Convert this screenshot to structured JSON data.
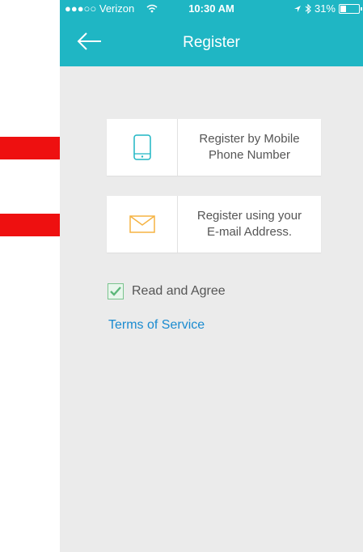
{
  "status_bar": {
    "carrier": "●●●○○ Verizon",
    "time": "10:30 AM",
    "battery": "31%",
    "battery_level": 0.31
  },
  "header": {
    "title": "Register",
    "back_icon": "arrow-left-icon"
  },
  "options": [
    {
      "label": "Register by Mobile\nPhone Number",
      "icon": "mobile-phone-icon",
      "icon_color": "#1fb6c4"
    },
    {
      "label": "Register using your\nE-mail Address.",
      "icon": "envelope-icon",
      "icon_color": "#f5b342"
    }
  ],
  "agreement": {
    "label": "Read and Agree",
    "checked": true,
    "terms_link": "Terms of Service"
  },
  "colors": {
    "header": "#1fb6c4",
    "background": "#ebebeb",
    "link": "#1a8bd0",
    "checkbox": "#5cb87a",
    "annotation_arrow": "#ee1010"
  }
}
